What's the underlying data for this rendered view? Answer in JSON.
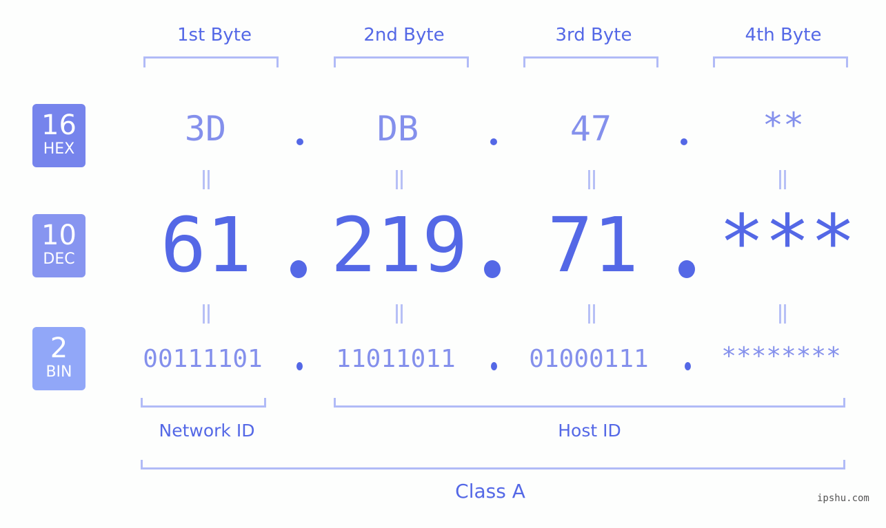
{
  "bytes": {
    "headers": [
      "1st Byte",
      "2nd Byte",
      "3rd Byte",
      "4th Byte"
    ]
  },
  "badges": {
    "hex": {
      "number": "16",
      "label": "HEX",
      "color": "#7684ec"
    },
    "dec": {
      "number": "10",
      "label": "DEC",
      "color": "#8795f0"
    },
    "bin": {
      "number": "2",
      "label": "BIN",
      "color": "#91a7f8"
    }
  },
  "hex_values": [
    "3D",
    "DB",
    "47",
    "**"
  ],
  "dec_values": [
    "61",
    "219",
    "71",
    "***"
  ],
  "bin_values": [
    "00111101",
    "11011011",
    "01000111",
    "********"
  ],
  "separator": ".",
  "equals_symbol": "=",
  "labels": {
    "network_id": "Network ID",
    "host_id": "Host ID",
    "class": "Class A"
  },
  "watermark": "ipshu.com",
  "colors": {
    "accent": "#5468e6",
    "light_accent": "#8490ec",
    "bracket": "#b1bbf7",
    "background": "#fdfefd"
  }
}
